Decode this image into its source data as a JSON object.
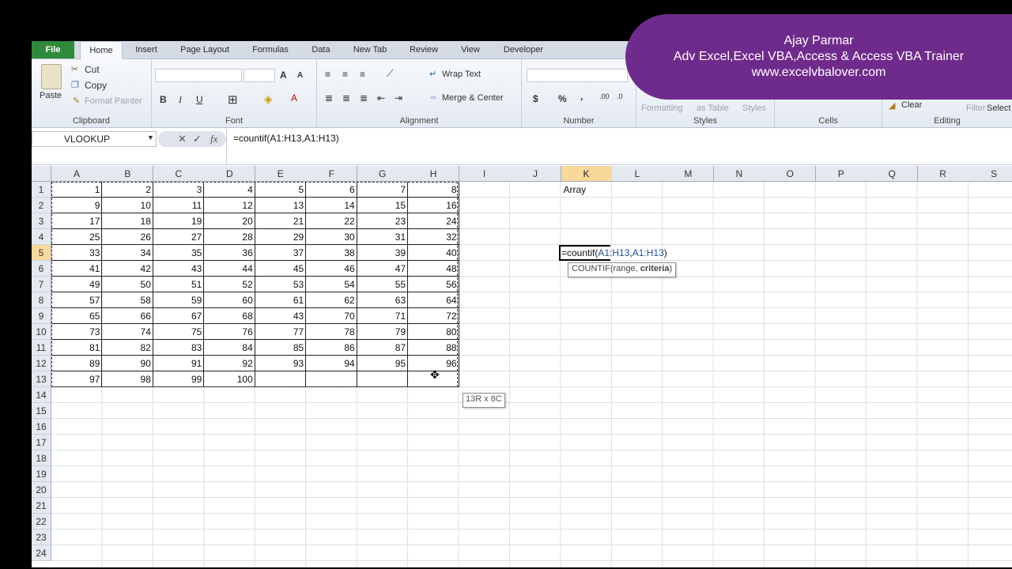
{
  "tabs": [
    "File",
    "Home",
    "Insert",
    "Page Layout",
    "Formulas",
    "Data",
    "New Tab",
    "Review",
    "View",
    "Developer"
  ],
  "ribbon": {
    "clipboard": {
      "label": "Clipboard",
      "paste": "Paste",
      "cut": "Cut",
      "copy": "Copy",
      "format_painter": "Format Painter"
    },
    "font": {
      "label": "Font",
      "bold": "B",
      "italic": "I",
      "underline": "U",
      "grow": "A",
      "shrink": "A"
    },
    "alignment": {
      "label": "Alignment",
      "wrap_text": "Wrap Text",
      "merge_center": "Merge & Center"
    },
    "number": {
      "label": "Number",
      "currency": "$",
      "percent": "%",
      "comma": ","
    },
    "styles": {
      "label": "Styles",
      "formatting": "Formatting",
      "as_table": "as Table",
      "cell_styles": "Styles"
    },
    "cells": {
      "label": "Cells"
    },
    "editing": {
      "label": "Editing",
      "clear": "Clear",
      "filter": "Filter",
      "select": "Select"
    }
  },
  "formula_bar": {
    "name_box": "VLOOKUP",
    "cancel_icon": "✕",
    "enter_icon": "✓",
    "fx": "fx",
    "formula": "=countif(A1:H13,A1:H13)"
  },
  "grid": {
    "columns": [
      "A",
      "B",
      "C",
      "D",
      "E",
      "F",
      "G",
      "H",
      "I",
      "J",
      "K",
      "L",
      "M",
      "N",
      "O",
      "P",
      "Q",
      "R",
      "S"
    ],
    "rows": [
      "1",
      "2",
      "3",
      "4",
      "5",
      "6",
      "7",
      "8",
      "9",
      "10",
      "11",
      "12",
      "13",
      "14",
      "15",
      "16",
      "17",
      "18",
      "19",
      "20",
      "21",
      "22",
      "23",
      "24"
    ],
    "data": [
      [
        "1",
        "2",
        "3",
        "4",
        "5",
        "6",
        "7",
        "8"
      ],
      [
        "9",
        "10",
        "11",
        "12",
        "13",
        "14",
        "15",
        "16"
      ],
      [
        "17",
        "18",
        "19",
        "20",
        "21",
        "22",
        "23",
        "24"
      ],
      [
        "25",
        "26",
        "27",
        "28",
        "29",
        "30",
        "31",
        "32"
      ],
      [
        "33",
        "34",
        "35",
        "36",
        "37",
        "38",
        "39",
        "40"
      ],
      [
        "41",
        "42",
        "43",
        "44",
        "45",
        "46",
        "47",
        "48"
      ],
      [
        "49",
        "50",
        "51",
        "52",
        "53",
        "54",
        "55",
        "56"
      ],
      [
        "57",
        "58",
        "59",
        "60",
        "61",
        "62",
        "63",
        "64"
      ],
      [
        "65",
        "66",
        "67",
        "68",
        "43",
        "70",
        "71",
        "72"
      ],
      [
        "73",
        "74",
        "75",
        "76",
        "77",
        "78",
        "79",
        "80"
      ],
      [
        "81",
        "82",
        "83",
        "84",
        "85",
        "86",
        "87",
        "88"
      ],
      [
        "89",
        "90",
        "91",
        "92",
        "93",
        "94",
        "95",
        "96"
      ],
      [
        "97",
        "98",
        "99",
        "100",
        "",
        "",
        "",
        ""
      ]
    ],
    "k1_text": "Array",
    "edit": {
      "prefix": "=countif(",
      "ref1": "A1:H13",
      "sep": ",",
      "ref2": "A1:H13",
      "suffix": ")"
    },
    "tooltip": {
      "fn": "COUNTIF(range, ",
      "arg": "criteria",
      "close": ")"
    },
    "size_tip": "13R x 8C",
    "selected_column": "K",
    "selected_row": "5"
  },
  "banner": {
    "name": "Ajay Parmar",
    "title": "Adv Excel,Excel VBA,Access & Access VBA Trainer",
    "website": "www.excelvbalover.com"
  }
}
